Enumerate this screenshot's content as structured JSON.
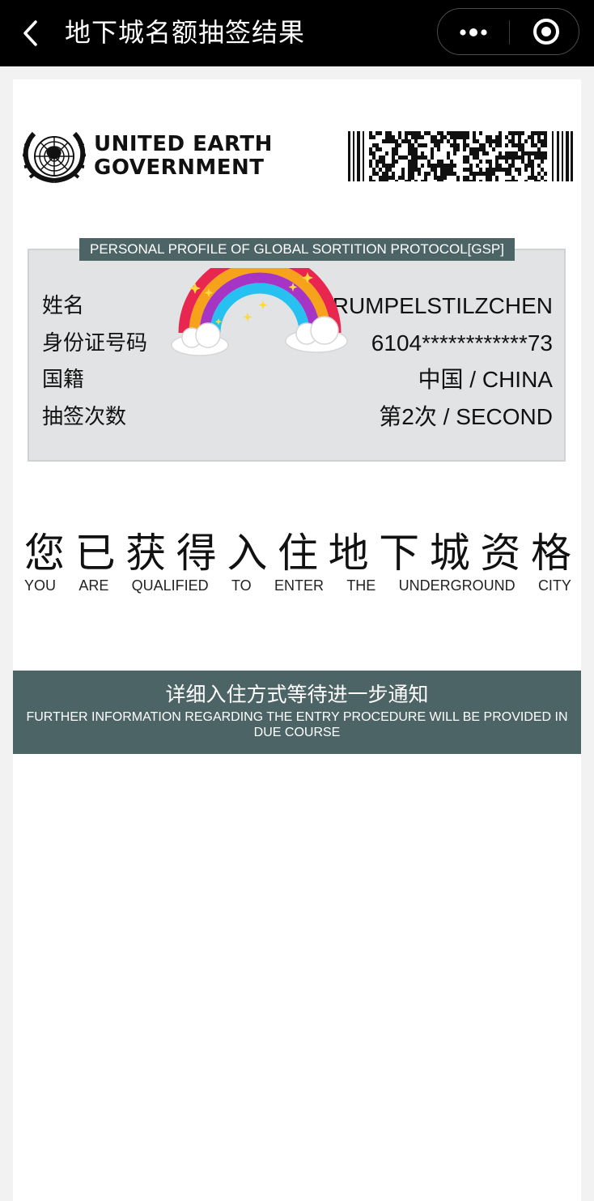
{
  "nav": {
    "back_icon": "chevron-left-icon",
    "title": "地下城名额抽签结果",
    "more_icon": "more-dots-icon",
    "close_icon": "target-close-icon"
  },
  "card": {
    "org_line1": "UNITED EARTH",
    "org_line2": "GOVERNMENT",
    "emblem_icon": "un-emblem-icon",
    "barcode_icon": "barcode-icon",
    "profile_header": "PERSONAL PROFILE OF GLOBAL SORTITION PROTOCOL[GSP]",
    "rows": [
      {
        "label": "姓名",
        "value": "RUMPELSTILZCHEN"
      },
      {
        "label": "身份证号码",
        "value": "6104************73"
      },
      {
        "label": "国籍",
        "value": "中国 / CHINA"
      },
      {
        "label": "抽签次数",
        "value": "第2次 / SECOND"
      }
    ],
    "sticker_icon": "rainbow-sticker-icon",
    "qualified_cn": [
      "您",
      "已",
      "获",
      "得",
      "入",
      "住",
      "地",
      "下",
      "城",
      "资",
      "格"
    ],
    "qualified_en": [
      "YOU",
      "ARE",
      "QUALIFIED",
      "TO",
      "ENTER",
      "THE",
      "UNDERGROUND",
      "CITY"
    ],
    "notice_cn": "详细入住方式等待进一步通知",
    "notice_en": "FURTHER INFORMATION REGARDING THE ENTRY PROCEDURE WILL BE PROVIDED IN DUE COURSE"
  },
  "colors": {
    "topbar": "#000000",
    "panel": "#4d6466",
    "profile_bg": "#e1e3e4"
  }
}
